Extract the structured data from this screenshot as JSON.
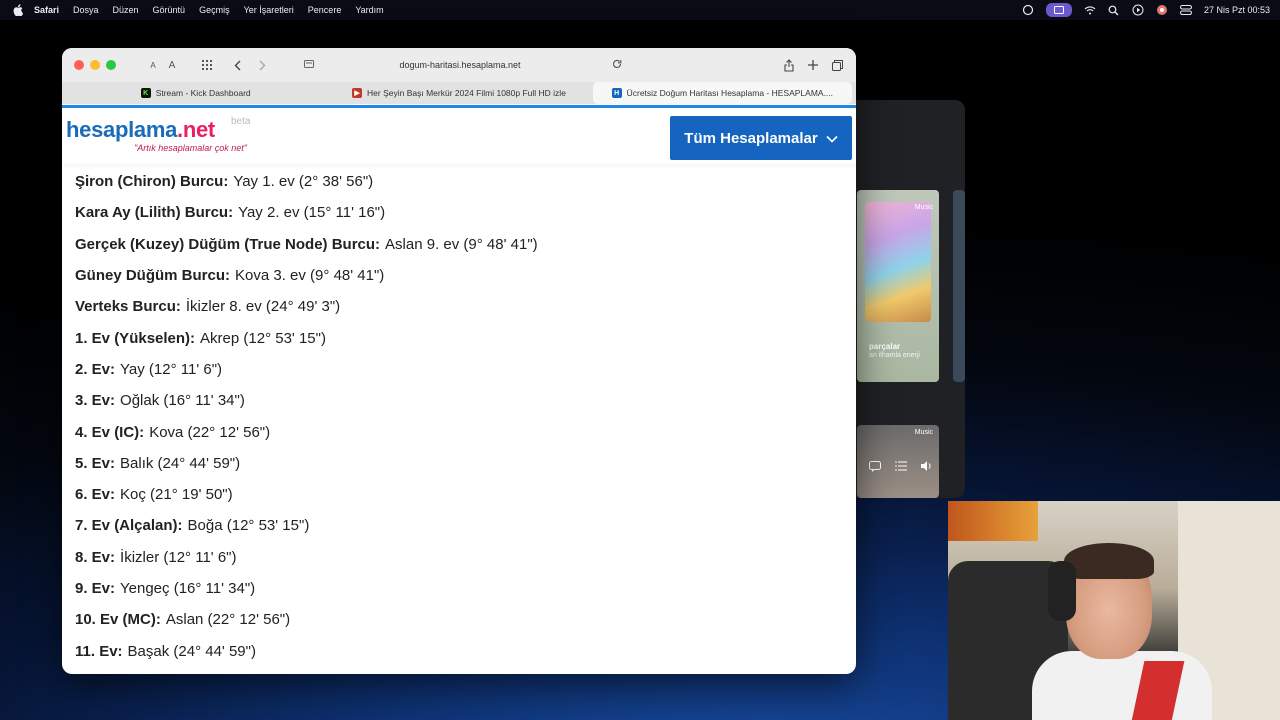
{
  "menubar": {
    "app": "Safari",
    "items": [
      "Dosya",
      "Düzen",
      "Görüntü",
      "Geçmiş",
      "Yer İşaretleri",
      "Pencere",
      "Yardım"
    ],
    "clock": "27 Nis Pzt  00:53"
  },
  "browser": {
    "text_small": "A",
    "text_large": "A",
    "address": "dogum-haritasi.hesaplama.net",
    "tabs": [
      {
        "label": "Stream - Kick Dashboard",
        "icon": "kick-favicon",
        "active": false
      },
      {
        "label": "Her Şeyin Başı Merkür 2024 Filmi 1080p Full HD izle",
        "icon": "film-favicon",
        "active": false
      },
      {
        "label": "Ücretsiz Doğum Haritası Hesaplama - HESAPLAMA....",
        "icon": "hesaplama-favicon",
        "active": true
      }
    ]
  },
  "site": {
    "logo_main": "hesaplama",
    "logo_tld": ".net",
    "beta": "beta",
    "tagline": "\"Artık hesaplamalar çok net\"",
    "all_calcs": "Tüm Hesaplamalar"
  },
  "results": [
    {
      "label": "Şiron (Chiron) Burcu:",
      "value": "Yay 1. ev (2° 38' 56\")"
    },
    {
      "label": "Kara Ay (Lilith) Burcu:",
      "value": "Yay 2. ev (15° 11' 16\")"
    },
    {
      "label": "Gerçek (Kuzey) Düğüm (True Node) Burcu:",
      "value": "Aslan 9. ev (9° 48' 41\")"
    },
    {
      "label": "Güney Düğüm Burcu:",
      "value": "Kova 3. ev (9° 48' 41\")"
    },
    {
      "label": "Verteks Burcu:",
      "value": "İkizler 8. ev (24° 49' 3\")"
    },
    {
      "label": "1. Ev (Yükselen):",
      "value": "Akrep (12° 53' 15\")"
    },
    {
      "label": "2. Ev:",
      "value": "Yay (12° 11' 6\")"
    },
    {
      "label": "3. Ev:",
      "value": "Oğlak (16° 11' 34\")"
    },
    {
      "label": "4. Ev (IC):",
      "value": "Kova (22° 12' 56\")"
    },
    {
      "label": "5. Ev:",
      "value": "Balık (24° 44' 59\")"
    },
    {
      "label": "6. Ev:",
      "value": "Koç (21° 19' 50\")"
    },
    {
      "label": "7. Ev (Alçalan):",
      "value": "Boğa (12° 53' 15\")"
    },
    {
      "label": "8. Ev:",
      "value": "İkizler (12° 11' 6\")"
    },
    {
      "label": "9. Ev:",
      "value": "Yengeç (16° 11' 34\")"
    },
    {
      "label": "10. Ev (MC):",
      "value": "Aslan (22° 12' 56\")"
    },
    {
      "label": "11. Ev:",
      "value": "Başak (24° 44' 59\")"
    }
  ],
  "music_widget": {
    "tag": "Music",
    "card_title": "parçalar",
    "card_subtitle": "an ilhamla enerji"
  }
}
